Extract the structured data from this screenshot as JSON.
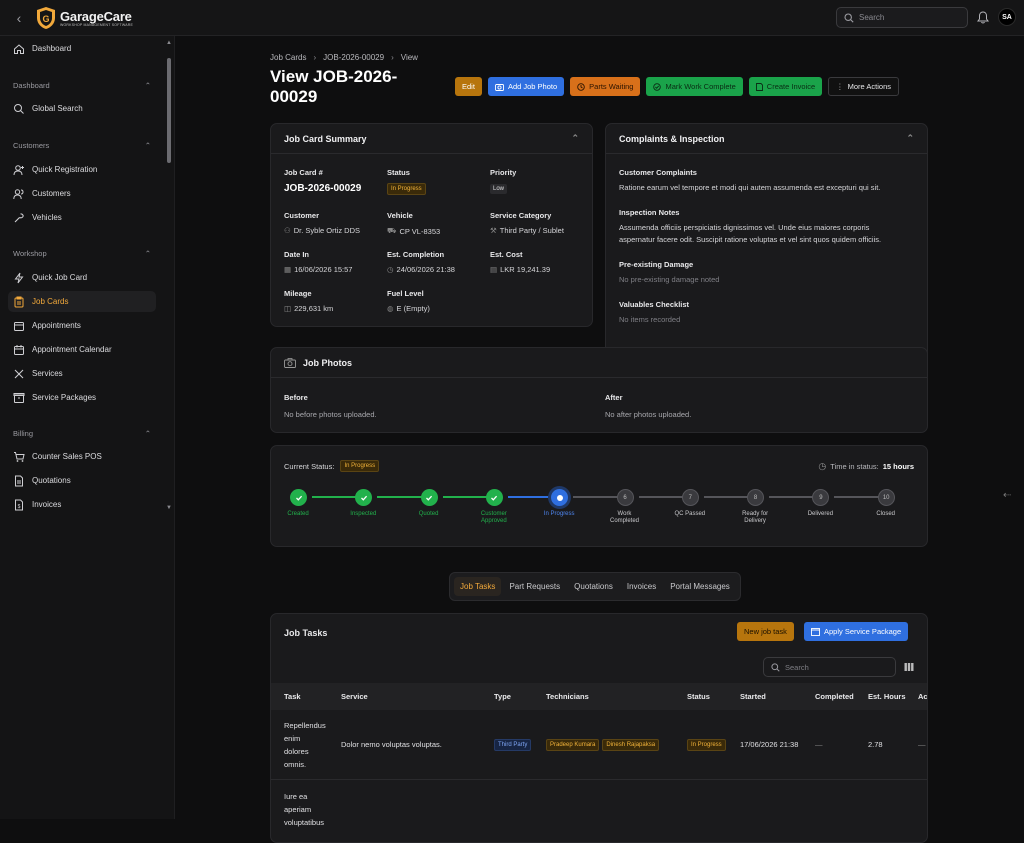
{
  "app": {
    "name": "GarageCare",
    "tagline": "WORKSHOP MANAGEMENT SOFTWARE",
    "search_placeholder": "Search",
    "avatar": "SA"
  },
  "sidebar": {
    "dashboard": "Dashboard",
    "sections": [
      {
        "title": "Dashboard",
        "items": [
          "Global Search"
        ]
      },
      {
        "title": "Customers",
        "items": [
          "Quick Registration",
          "Customers",
          "Vehicles"
        ]
      },
      {
        "title": "Workshop",
        "items": [
          "Quick Job Card",
          "Job Cards",
          "Appointments",
          "Appointment Calendar",
          "Services",
          "Service Packages"
        ]
      },
      {
        "title": "Billing",
        "items": [
          "Counter Sales POS",
          "Quotations",
          "Invoices"
        ]
      }
    ]
  },
  "breadcrumb": [
    "Job Cards",
    "JOB-2026-00029",
    "View"
  ],
  "page_title": "View JOB-2026-00029",
  "actions": {
    "edit": "Edit",
    "add_photo": "Add Job Photo",
    "parts_waiting": "Parts Waiting",
    "mark_complete": "Mark Work Complete",
    "create_invoice": "Create Invoice",
    "more": "More Actions"
  },
  "summary": {
    "title": "Job Card Summary",
    "job_card_label": "Job Card #",
    "job_card": "JOB-2026-00029",
    "status_label": "Status",
    "status": "In Progress",
    "priority_label": "Priority",
    "priority": "Low",
    "customer_label": "Customer",
    "customer": "Dr. Syble Ortiz DDS",
    "vehicle_label": "Vehicle",
    "vehicle": "CP VL-8353",
    "category_label": "Service Category",
    "category": "Third Party / Sublet",
    "date_in_label": "Date In",
    "date_in": "16/06/2026 15:57",
    "est_completion_label": "Est. Completion",
    "est_completion": "24/06/2026 21:38",
    "est_cost_label": "Est. Cost",
    "est_cost": "LKR 19,241.39",
    "mileage_label": "Mileage",
    "mileage": "229,631 km",
    "fuel_label": "Fuel Level",
    "fuel": "E (Empty)"
  },
  "complaints": {
    "title": "Complaints & Inspection",
    "customer_complaints_label": "Customer Complaints",
    "customer_complaints": "Ratione earum vel tempore et modi qui autem assumenda est excepturi qui sit.",
    "inspection_label": "Inspection Notes",
    "inspection_line1": "Assumenda officiis perspiciatis dignissimos vel. Unde eius maiores corporis",
    "inspection_line2": "aspernatur facere odit. Suscipit ratione voluptas et vel sint quos quidem officiis.",
    "damage_label": "Pre-existing Damage",
    "damage": "No pre-existing damage noted",
    "valuables_label": "Valuables Checklist",
    "valuables": "No items recorded"
  },
  "photos": {
    "title": "Job Photos",
    "before_label": "Before",
    "before": "No before photos uploaded.",
    "after_label": "After",
    "after": "No after photos uploaded."
  },
  "status_tracker": {
    "current_label": "Current Status:",
    "current": "In Progress",
    "time_label": "Time in status:",
    "time": "15 hours",
    "steps": [
      {
        "label1": "Created",
        "label2": "",
        "state": "done",
        "num": ""
      },
      {
        "label1": "Inspected",
        "label2": "",
        "state": "done",
        "num": ""
      },
      {
        "label1": "Quoted",
        "label2": "",
        "state": "done",
        "num": ""
      },
      {
        "label1": "Customer",
        "label2": "Approved",
        "state": "done",
        "num": ""
      },
      {
        "label1": "In Progress",
        "label2": "",
        "state": "current",
        "num": ""
      },
      {
        "label1": "Work",
        "label2": "Completed",
        "state": "pending",
        "num": "6"
      },
      {
        "label1": "QC Passed",
        "label2": "",
        "state": "pending",
        "num": "7"
      },
      {
        "label1": "Ready for",
        "label2": "Delivery",
        "state": "pending",
        "num": "8"
      },
      {
        "label1": "Delivered",
        "label2": "",
        "state": "pending",
        "num": "9"
      },
      {
        "label1": "Closed",
        "label2": "",
        "state": "pending",
        "num": "10"
      }
    ]
  },
  "tabs": [
    "Job Tasks",
    "Part Requests",
    "Quotations",
    "Invoices",
    "Portal Messages"
  ],
  "tasks": {
    "title": "Job Tasks",
    "new_task": "New job task",
    "apply_package": "Apply Service Package",
    "search_placeholder": "Search",
    "columns": [
      "Task",
      "Service",
      "Type",
      "Technicians",
      "Status",
      "Started",
      "Completed",
      "Est. Hours",
      "Ac"
    ],
    "rows": [
      {
        "task": [
          "Repellendus",
          "enim",
          "dolores",
          "omnis."
        ],
        "service": "Dolor nemo voluptas voluptas.",
        "type": "Third Party",
        "technicians": [
          "Pradeep Kumara",
          "Dinesh Rajapaksa"
        ],
        "status": "In Progress",
        "started": "17/06/2026 21:38",
        "completed": "—",
        "hours": "2.78",
        "action": "—"
      },
      {
        "task": [
          "Iure ea",
          "aperiam",
          "voluptatibus"
        ],
        "service": "",
        "type": "",
        "technicians": [],
        "status": "",
        "started": "",
        "completed": "",
        "hours": "",
        "action": ""
      }
    ]
  }
}
